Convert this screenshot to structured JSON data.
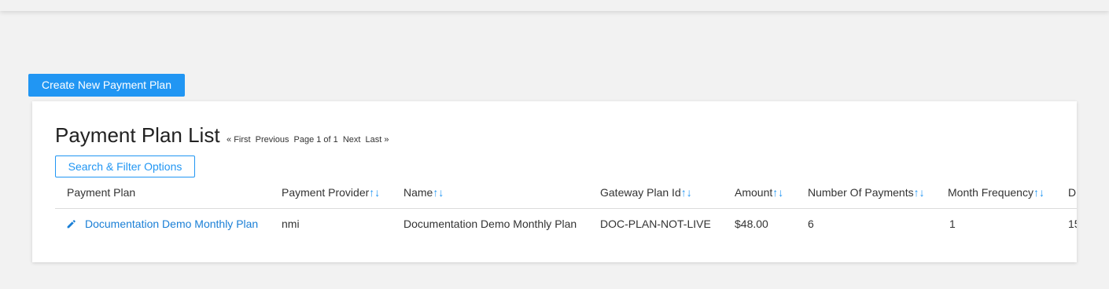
{
  "toolbar": {
    "create_label": "Create New Payment Plan"
  },
  "panel": {
    "title": "Payment Plan List",
    "pager": {
      "first": "« First",
      "previous": "Previous",
      "page_info": "Page 1 of 1",
      "next": "Next",
      "last": "Last »"
    },
    "filter_label": "Search & Filter Options"
  },
  "table": {
    "sort_glyph": "↑↓",
    "columns": [
      "Payment Plan",
      "Payment Provider",
      "Name",
      "Gateway Plan Id",
      "Amount",
      "Number Of Payments",
      "Month Frequency",
      "D"
    ],
    "rows": [
      {
        "payment_plan": "Documentation Demo Monthly Plan",
        "payment_provider": "nmi",
        "name": "Documentation Demo Monthly Plan",
        "gateway_plan_id": "DOC-PLAN-NOT-LIVE",
        "amount": "$48.00",
        "number_of_payments": "6",
        "month_frequency": "1",
        "truncated": "15"
      }
    ]
  },
  "icons": {
    "edit": "pencil-icon"
  },
  "colors": {
    "accent": "#2196f3",
    "link": "#1a7fd6",
    "background": "#f2f2f2"
  }
}
